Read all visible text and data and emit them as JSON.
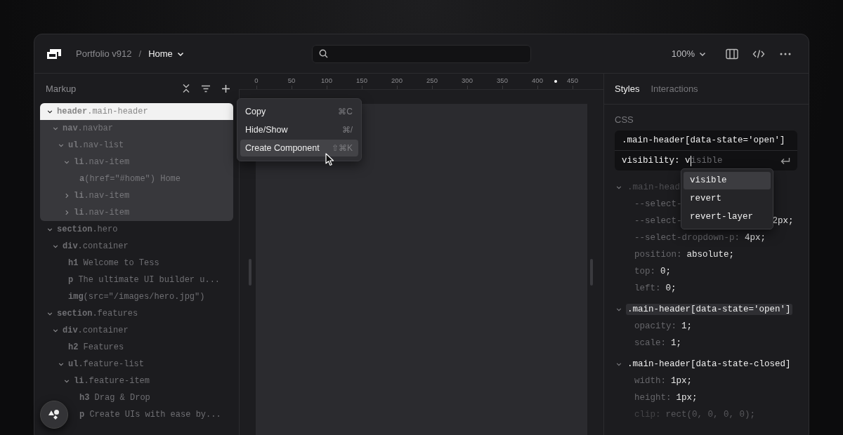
{
  "topbar": {
    "project": "Portfolio v912",
    "separator": "/",
    "page": "Home",
    "zoom": "100%"
  },
  "markup_panel": {
    "title": "Markup",
    "tree": [
      {
        "label": "**header**.main-header",
        "expanded": true,
        "selected": true,
        "children": [
          {
            "label": "**nav**.navbar",
            "expanded": true,
            "selected": false,
            "children": [
              {
                "label": "**ul**.nav-list",
                "expanded": true,
                "selected": false,
                "children": [
                  {
                    "label": "**li**.nav-item",
                    "expanded": true,
                    "selected": false,
                    "children": [
                      {
                        "label": "**a**(href=\"#home\") Home",
                        "selected": false
                      }
                    ]
                  },
                  {
                    "label": "**li**.nav-item",
                    "expanded": false,
                    "selected": false
                  },
                  {
                    "label": "**li**.nav-item",
                    "expanded": false,
                    "selected": false
                  }
                ]
              }
            ]
          }
        ]
      },
      {
        "label": "**section**.hero",
        "expanded": true,
        "selected": false,
        "children": [
          {
            "label": "**div**.container",
            "expanded": true,
            "selected": false,
            "children": [
              {
                "label": "**h1** Welcome to Tess",
                "selected": false
              },
              {
                "label": "**p** The ultimate UI builder u...",
                "selected": false
              },
              {
                "label": "**img**(src=\"/images/hero.jpg\")",
                "selected": false
              }
            ]
          }
        ]
      },
      {
        "label": "**section**.features",
        "expanded": true,
        "selected": false,
        "children": [
          {
            "label": "**div**.container",
            "expanded": true,
            "selected": false,
            "children": [
              {
                "label": "**h2** Features",
                "selected": false
              },
              {
                "label": "**ul**.feature-list",
                "expanded": true,
                "selected": false,
                "children": [
                  {
                    "label": "**li**.feature-item",
                    "expanded": true,
                    "selected": false,
                    "children": [
                      {
                        "label": "**h3** Drag & Drop",
                        "selected": false
                      },
                      {
                        "label": "**p** Create UIs with ease by...",
                        "selected": false
                      }
                    ]
                  }
                ]
              }
            ]
          }
        ]
      }
    ]
  },
  "context_menu": [
    {
      "label": "Copy",
      "shortcut": "⌘C",
      "selected": false
    },
    {
      "label": "Hide/Show",
      "shortcut": "⌘/",
      "selected": false
    },
    {
      "label": "Create Component",
      "shortcut": "⇧⌘K",
      "selected": true
    }
  ],
  "ruler": {
    "ticks": [
      "0",
      "50",
      "100",
      "150",
      "200",
      "250",
      "300",
      "350",
      "400",
      "450"
    ]
  },
  "inspector": {
    "tabs": [
      {
        "label": "Styles",
        "selected": true
      },
      {
        "label": "Interactions",
        "selected": false
      }
    ],
    "section": "CSS",
    "editor": {
      "selector": ".main-header[data-state='open']",
      "typed": "visibility: v",
      "suggestion": "isible"
    },
    "autocomplete": [
      {
        "label": "visible",
        "selected": true
      },
      {
        "label": "revert",
        "selected": false
      },
      {
        "label": "revert-layer",
        "selected": false
      }
    ],
    "rules": [
      {
        "selector": ".main-head",
        "dimmed": true,
        "highlighted": false,
        "expanded": true,
        "declarations": [
          {
            "property": "--select-"
          },
          {
            "property": "--select-",
            "value": "2px;",
            "covered": true
          },
          {
            "property": "--select-dropdown-p:",
            "value": "4px;",
            "covered": false
          },
          {
            "property": "position:",
            "value": "absolute;",
            "covered": false
          },
          {
            "property": "top:",
            "value": "0;",
            "covered": false
          },
          {
            "property": "left:",
            "value": "0;",
            "covered": false
          }
        ]
      },
      {
        "selector": ".main-header[data-state='open']",
        "dimmed": false,
        "highlighted": true,
        "expanded": true,
        "declarations": [
          {
            "property": "opacity:",
            "value": "1;",
            "covered": false
          },
          {
            "property": "scale:",
            "value": "1;",
            "covered": false
          }
        ]
      },
      {
        "selector": ".main-header[data-state-closed]",
        "dimmed": false,
        "highlighted": false,
        "expanded": true,
        "declarations": [
          {
            "property": "width:",
            "value": "1px;",
            "covered": false
          },
          {
            "property": "height:",
            "value": "1px;",
            "covered": false
          },
          {
            "property": "clip:",
            "value": "rect(0, 0, 0, 0);",
            "covered": false,
            "dimmed": true
          }
        ]
      }
    ]
  }
}
